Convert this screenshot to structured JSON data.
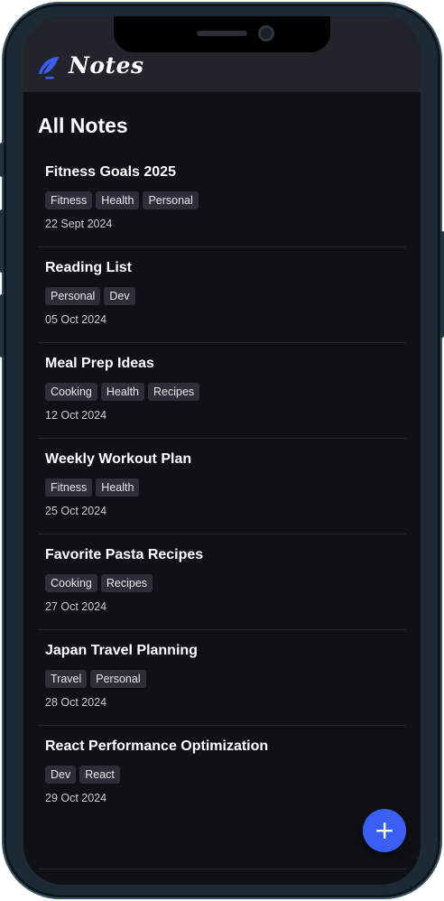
{
  "app": {
    "title": "Notes",
    "logo_icon": "feather-icon",
    "accent": "#3b5ff5"
  },
  "page": {
    "title": "All Notes"
  },
  "notes": [
    {
      "title": "Fitness Goals 2025",
      "tags": [
        "Fitness",
        "Health",
        "Personal"
      ],
      "date": "22 Sept 2024"
    },
    {
      "title": "Reading List",
      "tags": [
        "Personal",
        "Dev"
      ],
      "date": "05 Oct 2024"
    },
    {
      "title": "Meal Prep Ideas",
      "tags": [
        "Cooking",
        "Health",
        "Recipes"
      ],
      "date": "12 Oct 2024"
    },
    {
      "title": "Weekly Workout Plan",
      "tags": [
        "Fitness",
        "Health"
      ],
      "date": "25 Oct 2024"
    },
    {
      "title": "Favorite Pasta Recipes",
      "tags": [
        "Cooking",
        "Recipes"
      ],
      "date": "27 Oct 2024"
    },
    {
      "title": "Japan Travel Planning",
      "tags": [
        "Travel",
        "Personal"
      ],
      "date": "28 Oct 2024"
    },
    {
      "title": "React Performance Optimization",
      "tags": [
        "Dev",
        "React"
      ],
      "date": "29 Oct 2024"
    }
  ],
  "fab": {
    "icon": "plus-icon"
  }
}
